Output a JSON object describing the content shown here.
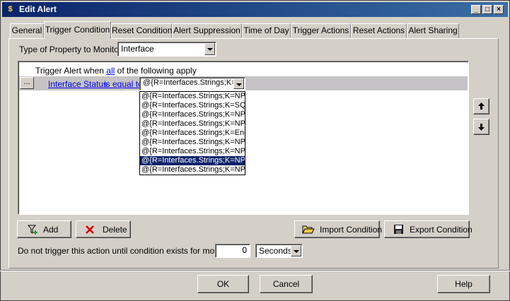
{
  "window": {
    "title": "Edit Alert",
    "controls": [
      "_",
      "□",
      "×"
    ]
  },
  "tabs": [
    {
      "label": "General",
      "active": false
    },
    {
      "label": "Trigger Condition",
      "active": true
    },
    {
      "label": "Reset Condition",
      "active": false
    },
    {
      "label": "Alert Suppression",
      "active": false
    },
    {
      "label": "Time of Day",
      "active": false
    },
    {
      "label": "Trigger Actions",
      "active": false
    },
    {
      "label": "Reset Actions",
      "active": false
    },
    {
      "label": "Alert Sharing",
      "active": false
    }
  ],
  "property": {
    "label": "Type of Property to Monitor:",
    "value": "Interface"
  },
  "condition": {
    "header_prefix": "Trigger Alert when",
    "header_link": "all",
    "header_suffix": "of the following apply",
    "ellipsis": "...",
    "field": "Interface Status",
    "operator": "is equal to",
    "value": "@{R=Interfaces.Strings;K="
  },
  "dropdown_options": [
    "@{R=Interfaces.Strings;K=NPM",
    "@{R=Interfaces.Strings;K=SQL",
    "@{R=Interfaces.Strings;K=NPM",
    "@{R=Interfaces.Strings;K=NPM",
    "@{R=Interfaces.Strings;K=Ene",
    "@{R=Interfaces.Strings;K=NPM",
    "@{R=Interfaces.Strings;K=NPM",
    "@{R=Interfaces.Strings;K=NPM",
    "@{R=Interfaces.Strings;K=NPM"
  ],
  "dropdown_selected_index": 7,
  "buttons": {
    "add": "Add",
    "delete": "Delete",
    "import": "Import Condition",
    "export": "Export Condition",
    "ok": "OK",
    "cancel": "Cancel",
    "help": "Help"
  },
  "delay": {
    "label": "Do not trigger this action until condition exists for more than",
    "value": "0",
    "unit": "Seconds"
  },
  "icons": {
    "app": "alert-icon",
    "add": "funnel-plus-icon",
    "delete": "red-x-icon",
    "import": "folder-open-icon",
    "export": "floppy-disk-icon",
    "move_up": "arrow-up-icon",
    "move_down": "arrow-down-icon"
  }
}
